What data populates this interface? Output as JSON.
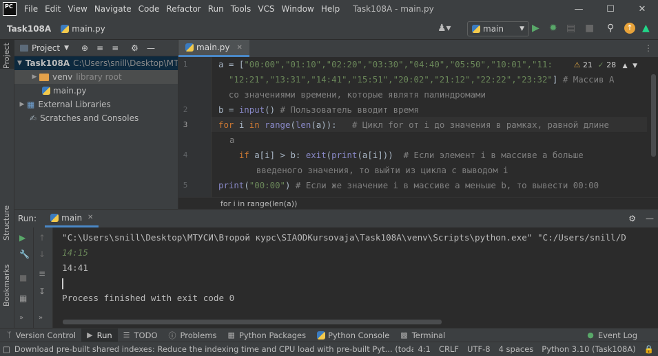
{
  "titlebar": {
    "logo": "PC",
    "menu": [
      "File",
      "Edit",
      "View",
      "Navigate",
      "Code",
      "Refactor",
      "Run",
      "Tools",
      "VCS",
      "Window",
      "Help"
    ],
    "title": "Task108A - main.py"
  },
  "navbar": {
    "project": "Task108A",
    "file": "main.py",
    "run_config": "main"
  },
  "side_labels": {
    "project": "Project",
    "structure": "Structure",
    "bookmarks": "Bookmarks"
  },
  "project_panel": {
    "title": "Project",
    "root": {
      "name": "Task108A",
      "path": "C:\\Users\\snill\\Desktop\\МТ"
    },
    "venv": {
      "name": "venv",
      "note": "library root"
    },
    "file": "main.py",
    "external": "External Libraries",
    "scratches": "Scratches and Consoles"
  },
  "editor": {
    "tab": "main.py",
    "inspections": {
      "warnings": "21",
      "weak": "28"
    },
    "line_numbers": [
      "1",
      "2",
      "3",
      "4",
      "5"
    ],
    "breadcrumb": "for i in range(len(a))",
    "code": {
      "l1a_a": "a = [",
      "l1a_items": "\"00:00\",\"01:10\",\"02:20\",\"03:30\",\"04:40\",\"05:50\",\"10:01\",\"11:",
      "l1b_items": "  \"12:21\",\"13:31\",\"14:41\",\"15:51\",\"20:02\",\"21:12\",\"22:22\",\"23:32\"",
      "l1b_end": "] ",
      "l1b_comment": "# Массив А",
      "l1c_comment": "  со значениями времени, которые являтя палиндромами",
      "l2_pre": "b = ",
      "l2_fn": "input",
      "l2_post": "() ",
      "l2_comment": "# Пользователь вводит время",
      "l3_for": "for",
      "l3_mid": " i ",
      "l3_in": "in",
      "l3_sp": " ",
      "l3_range": "range",
      "l3_p": "(",
      "l3_len": "len",
      "l3_rest": "(a)):   ",
      "l3_comment": "# Цикл for от i до значения в рамках, равной длине",
      "l3b": "а",
      "l4_if": "    if",
      "l4_mid": " a[i] > b: ",
      "l4_exit": "exit",
      "l4_p": "(",
      "l4_print": "print",
      "l4_rest": "(a[i]))  ",
      "l4_comment": "# Если элемент i в массиве а больше",
      "l4b_comment": "  введеного значения, то выйти из цикла с выводом i",
      "l5_print": "print",
      "l5_p": "(",
      "l5_str": "\"00:00\"",
      "l5_rest": ") ",
      "l5_comment": "# Если же значение i в массиве а меньше b, то вывести 00:00"
    }
  },
  "run_panel": {
    "label": "Run:",
    "tab": "main",
    "console": {
      "cmd": "\"C:\\Users\\snill\\Desktop\\МТУСИ\\Второй курс\\SIAODKursovaja\\Task108A\\venv\\Scripts\\python.exe\" \"C:/Users/snill/D",
      "input": "14:15",
      "output": "14:41",
      "finished": "Process finished with exit code 0"
    }
  },
  "tool_windows": {
    "items": [
      "Version Control",
      "Run",
      "TODO",
      "Problems",
      "Python Packages",
      "Python Console",
      "Terminal"
    ],
    "event_log": "Event Log"
  },
  "status": {
    "message": "Download pre-built shared indexes: Reduce the indexing time and CPU load with pre-built Pyt... (today 13:23)",
    "position": "4:1",
    "line_sep": "CRLF",
    "encoding": "UTF-8",
    "indent": "4 spaces",
    "interpreter": "Python 3.10 (Task108A)"
  },
  "colors": {
    "accent": "#4a88c7",
    "keyword": "#cc7832",
    "string": "#6a8759",
    "builtin": "#8888c6",
    "comment": "#808080"
  }
}
